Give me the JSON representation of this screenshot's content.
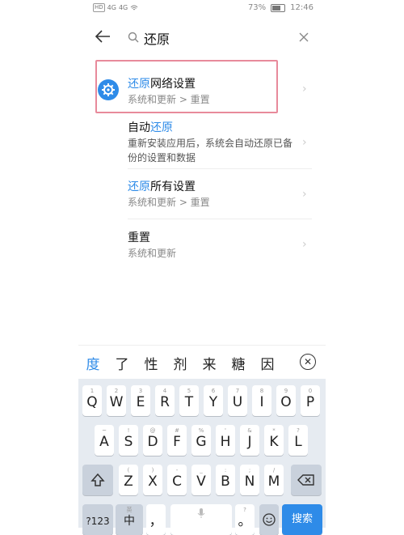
{
  "status_bar": {
    "left_icons": [
      "HD",
      "4G",
      "4G",
      "wifi-icon"
    ],
    "battery_pct": "73%",
    "battery_level": 0.73,
    "time": "12:46"
  },
  "search": {
    "query": "还原"
  },
  "results": [
    {
      "title_highlight": "还原",
      "title_rest": "网络设置",
      "subtitle": "系统和更新 > 重置"
    },
    {
      "title_prefix": "自动",
      "title_highlight": "还原",
      "subtitle": "重新安装应用后，系统会自动还原已备份的设置和数据"
    },
    {
      "title_highlight": "还原",
      "title_rest": "所有设置",
      "subtitle": "系统和更新 > 重置"
    },
    {
      "title": "重置",
      "subtitle": "系统和更新"
    }
  ],
  "candidates": [
    "度",
    "了",
    "性",
    "剂",
    "来",
    "糖",
    "因"
  ],
  "keyboard": {
    "row1": [
      {
        "key": "Q",
        "hint": "1"
      },
      {
        "key": "W",
        "hint": "2"
      },
      {
        "key": "E",
        "hint": "3"
      },
      {
        "key": "R",
        "hint": "4"
      },
      {
        "key": "T",
        "hint": "5"
      },
      {
        "key": "Y",
        "hint": "6"
      },
      {
        "key": "U",
        "hint": "7"
      },
      {
        "key": "I",
        "hint": "8"
      },
      {
        "key": "O",
        "hint": "9"
      },
      {
        "key": "P",
        "hint": "0"
      }
    ],
    "row2": [
      {
        "key": "A",
        "hint": "~"
      },
      {
        "key": "S",
        "hint": "!"
      },
      {
        "key": "D",
        "hint": "@"
      },
      {
        "key": "F",
        "hint": "#"
      },
      {
        "key": "G",
        "hint": "%"
      },
      {
        "key": "H",
        "hint": "'"
      },
      {
        "key": "J",
        "hint": "&"
      },
      {
        "key": "K",
        "hint": "*"
      },
      {
        "key": "L",
        "hint": "?"
      }
    ],
    "row3": [
      {
        "key": "Z",
        "hint": "("
      },
      {
        "key": "X",
        "hint": ")"
      },
      {
        "key": "C",
        "hint": "-"
      },
      {
        "key": "V",
        "hint": "_"
      },
      {
        "key": "B",
        "hint": ":"
      },
      {
        "key": "N",
        "hint": ";"
      },
      {
        "key": "M",
        "hint": "/"
      }
    ],
    "num_key": "?123",
    "lang_key": "中",
    "lang_key_hint": "英",
    "comma_key": "，",
    "period_key": "。",
    "period_hint": "?",
    "search_key": "搜索",
    "shift_icon": "shift-icon",
    "backspace_icon": "backspace-icon",
    "mic_icon": "mic-icon",
    "emoji_icon": "emoji-icon"
  },
  "colors": {
    "accent": "#2e8be8",
    "highlight_border": "#e88a9b"
  }
}
